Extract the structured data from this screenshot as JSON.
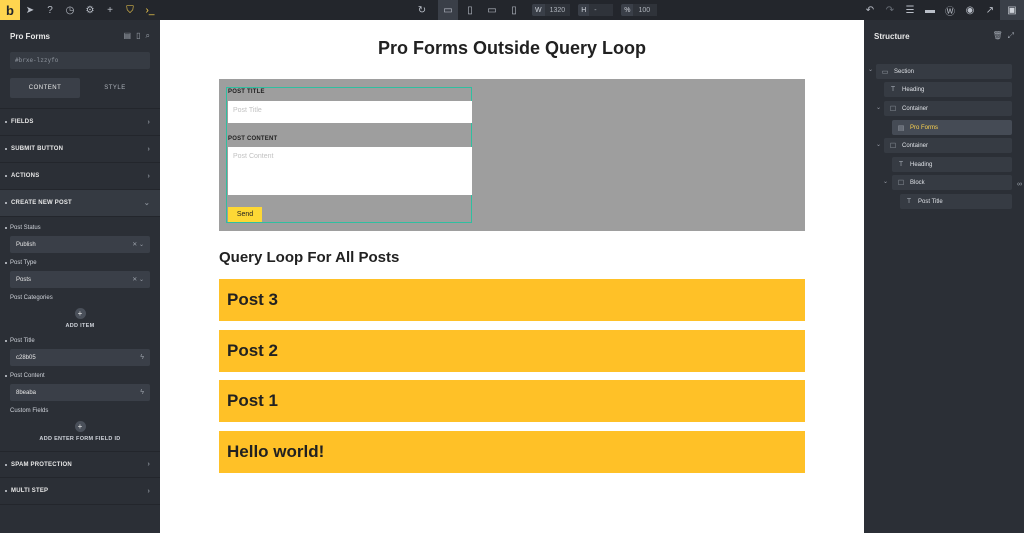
{
  "topbar": {
    "logo": "b",
    "left_icons": [
      "pointer-icon",
      "help-icon",
      "history-icon",
      "settings-icon",
      "add-icon",
      "shield-icon",
      "terminal-icon"
    ],
    "width_label": "W",
    "width_value": "1320",
    "height_label": "H",
    "height_value": "-",
    "zoom_label": "%",
    "zoom_value": "100"
  },
  "left_panel": {
    "title": "Pro Forms",
    "element_id": "#brxe-lzzyfo",
    "tabs": [
      "CONTENT",
      "STYLE"
    ],
    "sections": {
      "fields": "FIELDS",
      "submit_button": "SUBMIT BUTTON",
      "actions": "ACTIONS",
      "create_new_post": "CREATE NEW POST",
      "spam_protection": "SPAM PROTECTION",
      "multi_step": "MULTI STEP"
    },
    "post_status_label": "Post Status",
    "post_status_value": "Publish",
    "post_type_label": "Post Type",
    "post_type_value": "Posts",
    "post_categories_label": "Post Categories",
    "add_item": "ADD ITEM",
    "post_title_label": "Post Title",
    "post_title_value": "c28b05",
    "post_content_label": "Post Content",
    "post_content_value": "8beaba",
    "custom_fields_label": "Custom Fields",
    "add_field": "ADD ENTER FORM FIELD ID"
  },
  "canvas": {
    "page_title": "Pro Forms Outside Query Loop",
    "form": {
      "title_label": "POST TITLE",
      "title_placeholder": "Post Title",
      "content_label": "POST CONTENT",
      "content_placeholder": "Post Content",
      "submit": "Send"
    },
    "query_heading": "Query Loop For All Posts",
    "posts": [
      "Post 3",
      "Post 2",
      "Post 1",
      "Hello world!"
    ]
  },
  "structure": {
    "title": "Structure",
    "items": {
      "section": "Section",
      "heading_1": "Heading",
      "container_1": "Container",
      "pro_forms": "Pro Forms",
      "container_2": "Container",
      "heading_2": "Heading",
      "block": "Block",
      "post_title": "Post Title"
    }
  },
  "colors": {
    "accent": "#ffd54f",
    "post_card": "#ffc127",
    "form_background": "#9e9e9e",
    "selection_outline": "#2fbfa0"
  }
}
